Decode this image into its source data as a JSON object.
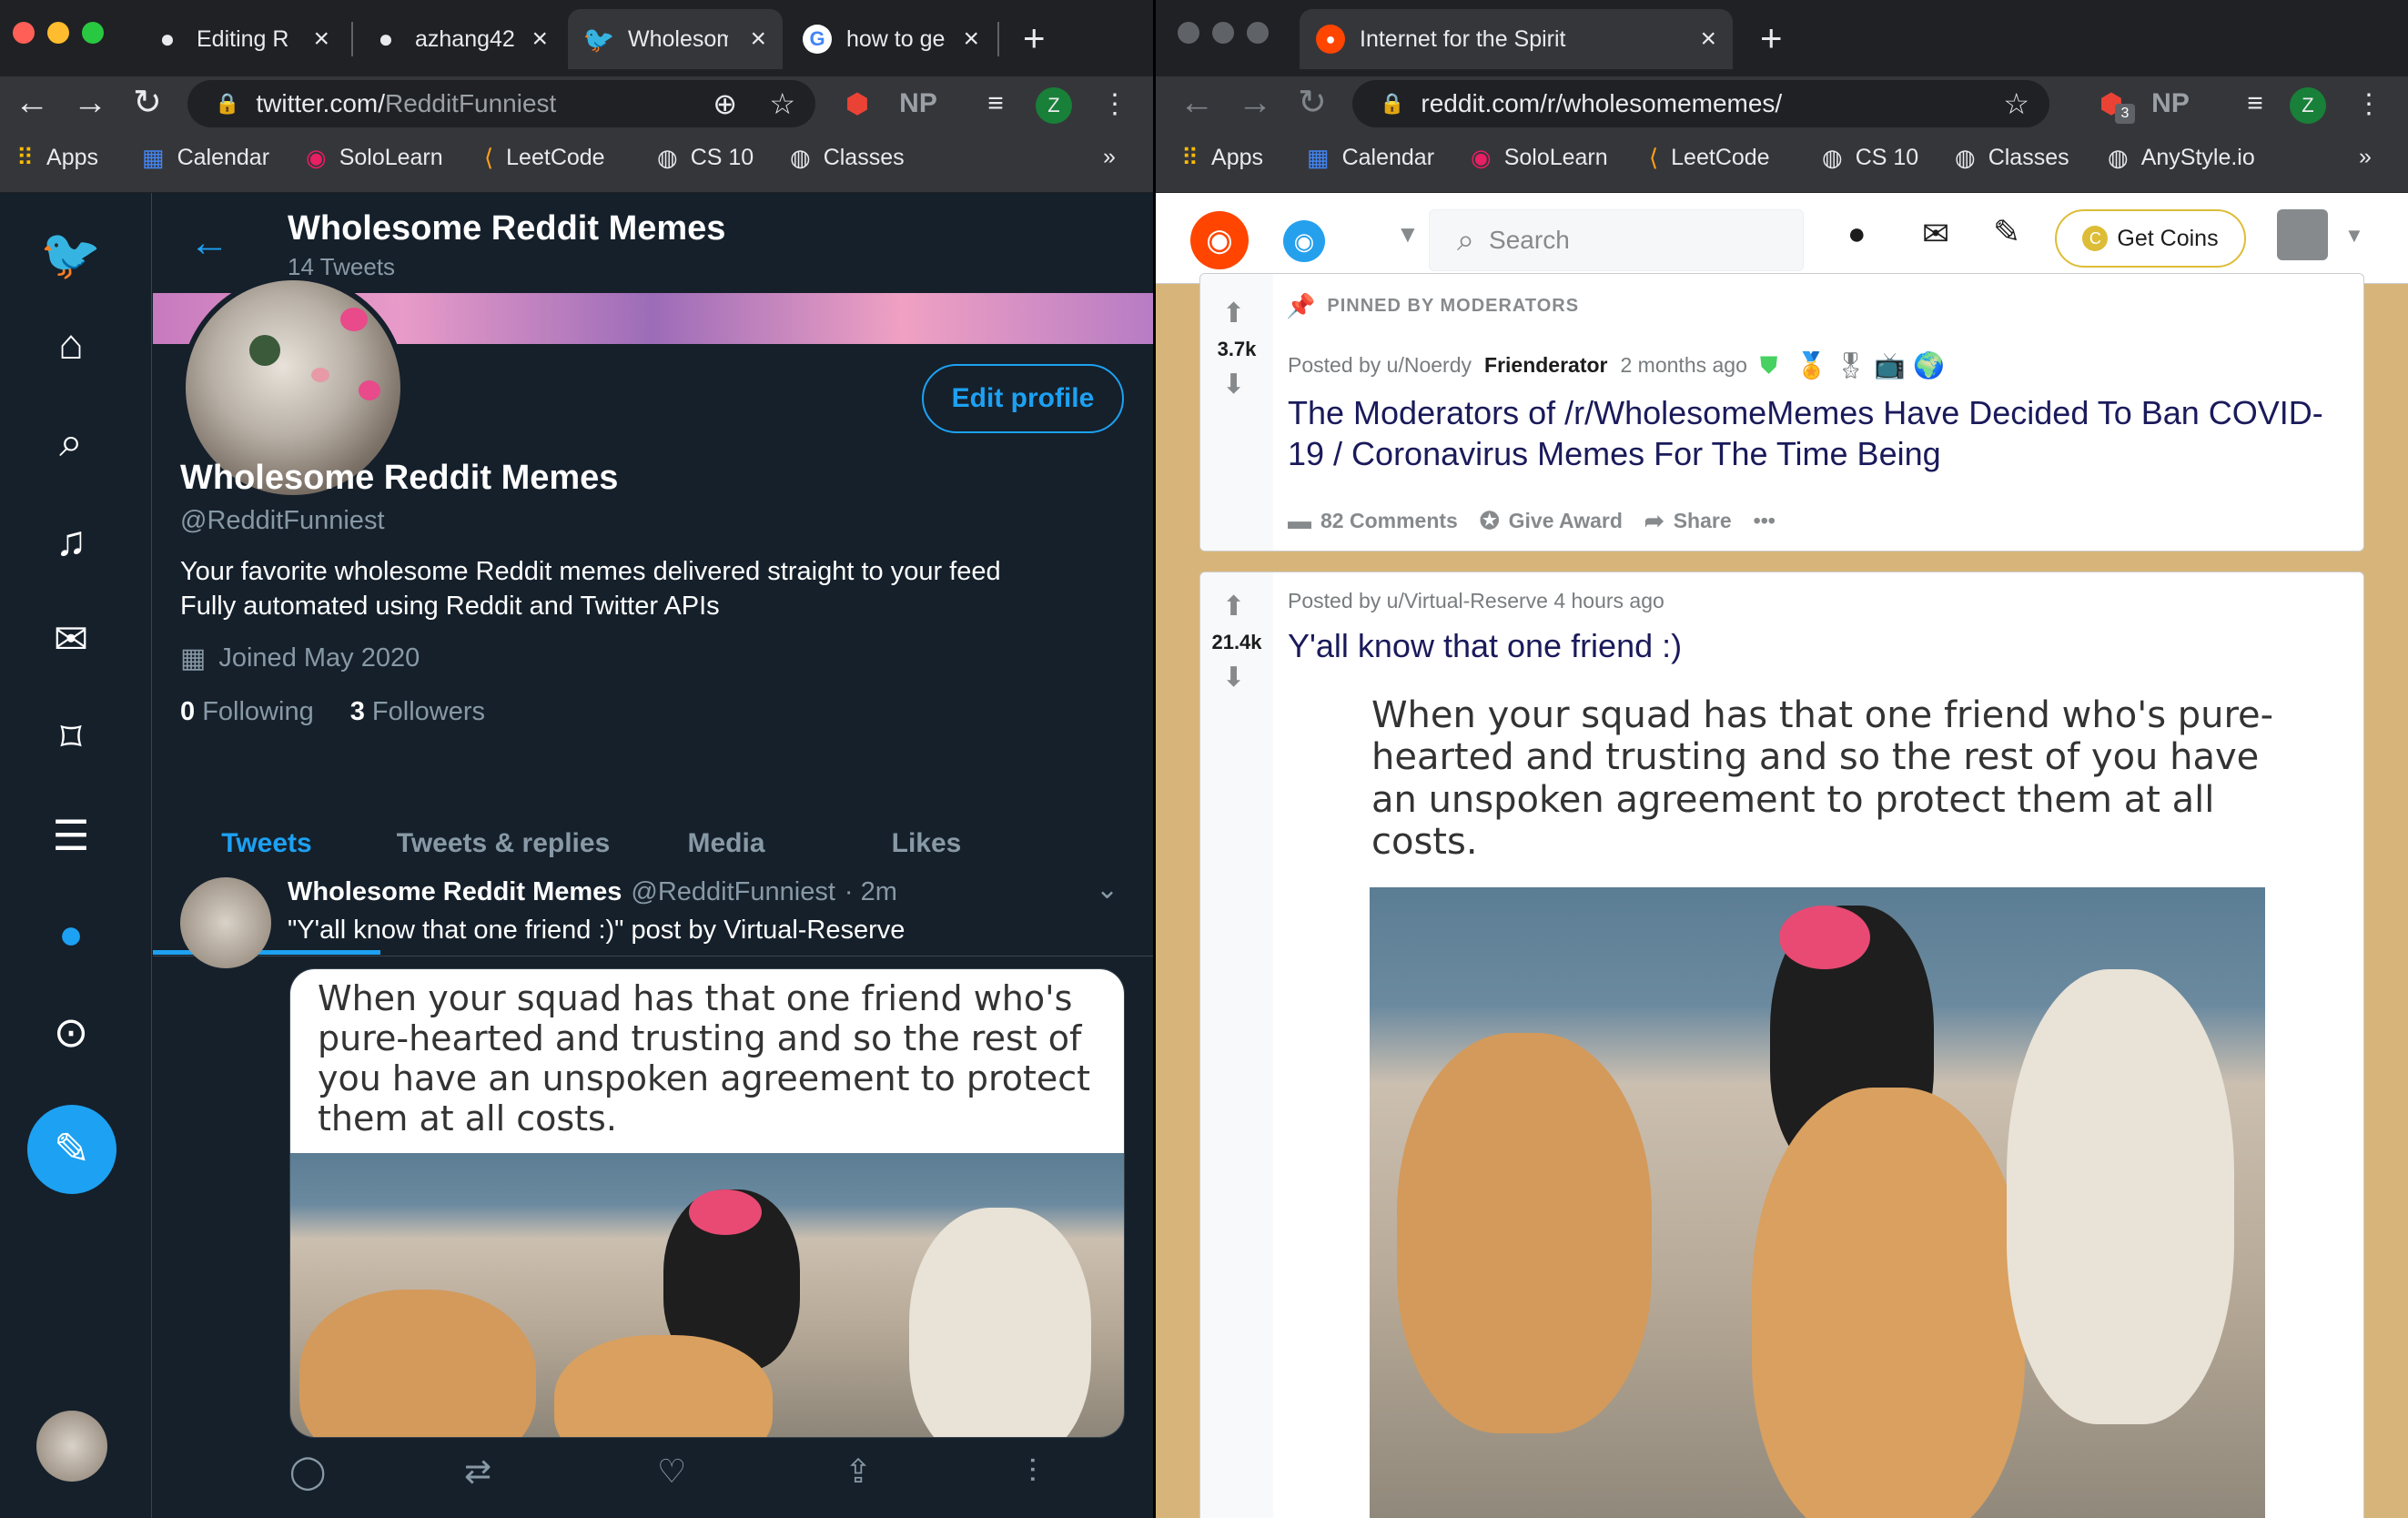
{
  "left_browser": {
    "tabs": [
      {
        "title": "Editing Re",
        "icon": "github-icon"
      },
      {
        "title": "azhang42",
        "icon": "github-icon"
      },
      {
        "title": "Wholesom",
        "icon": "twitter-icon"
      },
      {
        "title": "how to ge",
        "icon": "google-icon"
      }
    ],
    "url_host": "twitter.com/",
    "url_path": "RedditFunniest",
    "ext_np": "NP",
    "profile_initial": "Z",
    "bookmarks": [
      "Apps",
      "Calendar",
      "SoloLearn",
      "LeetCode",
      "CS 10",
      "Classes"
    ],
    "more": "»"
  },
  "right_browser": {
    "tabs": [
      {
        "title": "Internet for the Spirit",
        "icon": "reddit-icon"
      }
    ],
    "url_host": "reddit.com/",
    "url_path": "r/wholesomememes/",
    "ext_np": "NP",
    "ext_badge": "3",
    "profile_initial": "Z",
    "bookmarks": [
      "Apps",
      "Calendar",
      "SoloLearn",
      "LeetCode",
      "CS 10",
      "Classes",
      "AnyStyle.io"
    ],
    "more": "»"
  },
  "twitter": {
    "header_name": "Wholesome Reddit Memes",
    "header_count": "14 Tweets",
    "edit_profile": "Edit profile",
    "name": "Wholesome Reddit Memes",
    "handle": "@RedditFunniest",
    "bio_line1": "Your favorite wholesome Reddit memes delivered straight to your feed",
    "bio_line2": "Fully automated using Reddit and Twitter APIs",
    "joined": "Joined May 2020",
    "following_count": "0",
    "following_label": "Following",
    "followers_count": "3",
    "followers_label": "Followers",
    "tabs": [
      "Tweets",
      "Tweets & replies",
      "Media",
      "Likes"
    ],
    "tweet": {
      "author": "Wholesome Reddit Memes",
      "handle": "@RedditFunniest",
      "time": "· 2m",
      "text": "\"Y'all know that one friend :)\" post by Virtual-Reserve",
      "meme_caption": "When your squad has that one friend who's pure-hearted and trusting and so the rest of you have an unspoken agreement to protect them at all costs."
    }
  },
  "reddit": {
    "search_placeholder": "Search",
    "get_coins": "Get Coins",
    "pinned_label": "PINNED BY MODERATORS",
    "post1": {
      "votes": "3.7k",
      "posted_by": "Posted by u/Noerdy",
      "flair": "Frienderator",
      "time": "2 months ago",
      "title": "The Moderators of /r/WholesomeMemes Have Decided To Ban COVID-19 / Coronavirus Memes For The Time Being",
      "comments": "82 Comments",
      "give_award": "Give Award",
      "share": "Share",
      "more": "•••"
    },
    "post2": {
      "votes": "21.4k",
      "posted_by": "Posted by u/Virtual-Reserve 4 hours ago",
      "title": "Y'all know that one friend :)",
      "meme_caption": "When your squad has that one friend who's pure-hearted and trusting and so the rest of you have an unspoken agreement to protect them at all costs."
    }
  },
  "colors": {
    "twitter_bg": "#15202b",
    "twitter_blue": "#1da1f2",
    "reddit_orange": "#ff4500",
    "reddit_title": "#1a1a5b"
  }
}
